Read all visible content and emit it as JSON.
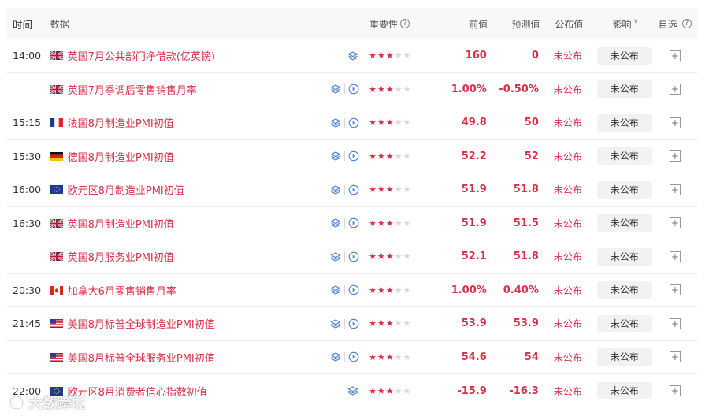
{
  "header": {
    "time": "时间",
    "data": "数据",
    "importance": "重要性",
    "previous": "前值",
    "forecast": "预测值",
    "published": "公布值",
    "impact": "影响",
    "impact_arrow": "▾",
    "favorite": "自选",
    "help": "?"
  },
  "rows": [
    {
      "time": "14:00",
      "flag": "uk",
      "name": "英国7月公共部门净借款(亿英镑)",
      "video": false,
      "stars": 3,
      "prev": "160",
      "fcst": "0",
      "pub": "未公布",
      "impact": "未公布"
    },
    {
      "time": "",
      "flag": "uk",
      "name": "英国7月季调后零售销售月率",
      "video": true,
      "stars": 3,
      "prev": "1.00%",
      "fcst": "-0.50%",
      "pub": "未公布",
      "impact": "未公布"
    },
    {
      "time": "15:15",
      "flag": "fr",
      "name": "法国8月制造业PMI初值",
      "video": true,
      "stars": 3,
      "prev": "49.8",
      "fcst": "50",
      "pub": "未公布",
      "impact": "未公布"
    },
    {
      "time": "15:30",
      "flag": "de",
      "name": "德国8月制造业PMI初值",
      "video": true,
      "stars": 3,
      "prev": "52.2",
      "fcst": "52",
      "pub": "未公布",
      "impact": "未公布"
    },
    {
      "time": "16:00",
      "flag": "eu",
      "name": "欧元区8月制造业PMI初值",
      "video": true,
      "stars": 3,
      "prev": "51.9",
      "fcst": "51.8",
      "pub": "未公布",
      "impact": "未公布"
    },
    {
      "time": "16:30",
      "flag": "uk",
      "name": "英国8月制造业PMI初值",
      "video": true,
      "stars": 3,
      "prev": "51.9",
      "fcst": "51.5",
      "pub": "未公布",
      "impact": "未公布"
    },
    {
      "time": "",
      "flag": "uk",
      "name": "英国8月服务业PMI初值",
      "video": true,
      "stars": 3,
      "prev": "52.1",
      "fcst": "51.8",
      "pub": "未公布",
      "impact": "未公布"
    },
    {
      "time": "20:30",
      "flag": "ca",
      "name": "加拿大6月零售销售月率",
      "video": true,
      "stars": 3,
      "prev": "1.00%",
      "fcst": "0.40%",
      "pub": "未公布",
      "impact": "未公布"
    },
    {
      "time": "21:45",
      "flag": "us",
      "name": "美国8月标普全球制造业PMI初值",
      "video": true,
      "stars": 3,
      "prev": "53.9",
      "fcst": "53.9",
      "pub": "未公布",
      "impact": "未公布"
    },
    {
      "time": "",
      "flag": "us",
      "name": "美国8月标普全球服务业PMI初值",
      "video": true,
      "stars": 3,
      "prev": "54.6",
      "fcst": "54",
      "pub": "未公布",
      "impact": "未公布"
    },
    {
      "time": "22:00",
      "flag": "eu",
      "name": "欧元区8月消费者信心指数初值",
      "video": false,
      "stars": 3,
      "prev": "-15.9",
      "fcst": "-16.3",
      "pub": "未公布",
      "impact": "未公布"
    }
  ],
  "max_stars": 5,
  "watermark": "大数跨境",
  "colors": {
    "accent": "#d9304a",
    "layer_icon": "#4a7fd0",
    "header_bg": "#f7f8fa"
  }
}
